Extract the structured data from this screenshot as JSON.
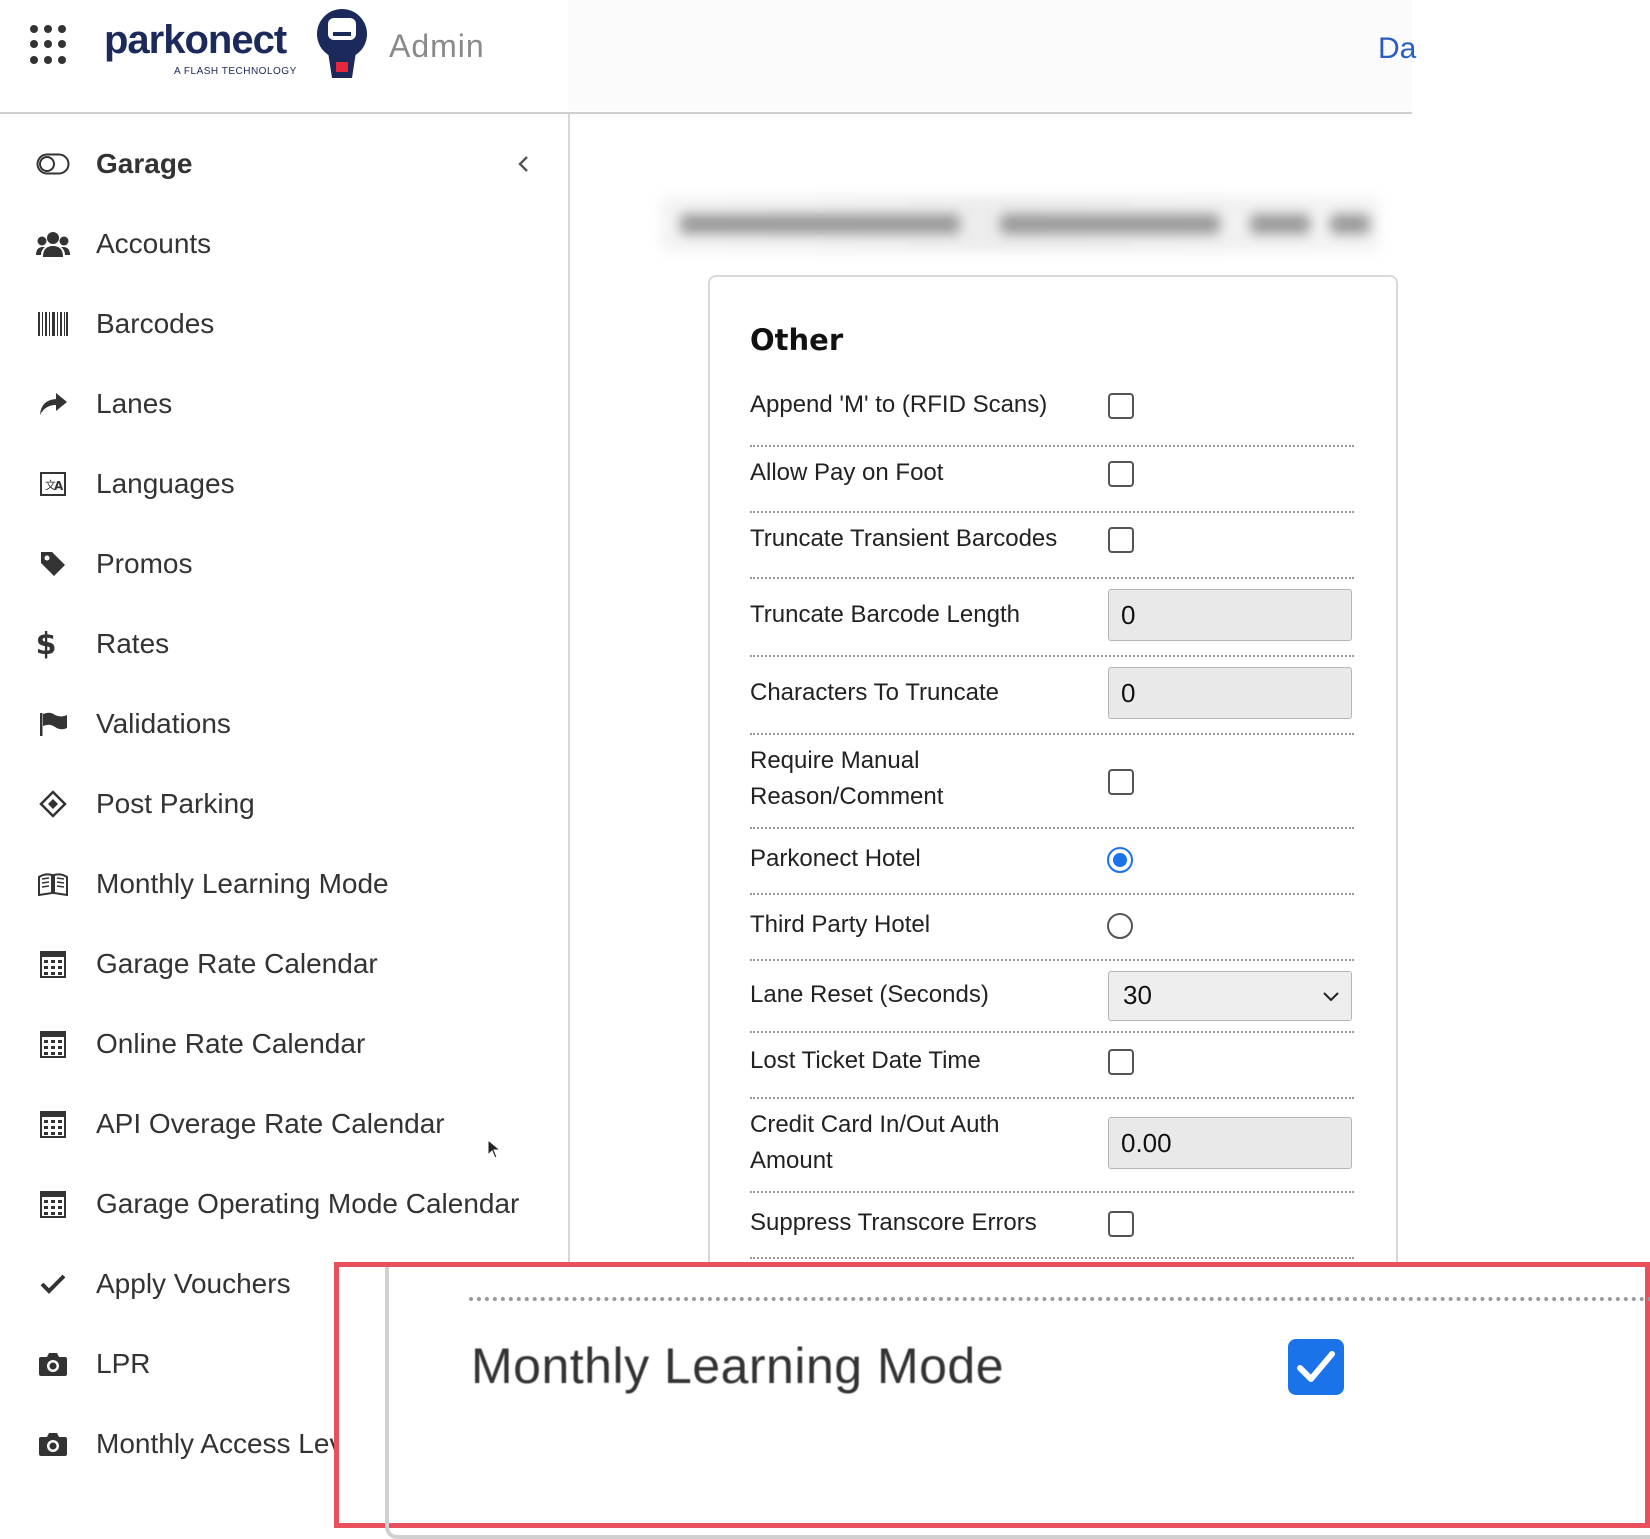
{
  "header": {
    "logo_text": "parkonect",
    "logo_tagline": "A FLASH TECHNOLOGY",
    "app_label": "Admin",
    "link_text": "Da"
  },
  "sidebar": {
    "items": [
      {
        "label": "Garage",
        "icon": "toggle-icon",
        "active": true
      },
      {
        "label": "Accounts",
        "icon": "users-icon"
      },
      {
        "label": "Barcodes",
        "icon": "barcode-icon"
      },
      {
        "label": "Lanes",
        "icon": "share-arrow-icon"
      },
      {
        "label": "Languages",
        "icon": "language-icon"
      },
      {
        "label": "Promos",
        "icon": "tag-icon"
      },
      {
        "label": "Rates",
        "icon": "dollar-icon"
      },
      {
        "label": "Validations",
        "icon": "flag-icon"
      },
      {
        "label": "Post Parking",
        "icon": "ticket-icon"
      },
      {
        "label": "Monthly Learning Mode",
        "icon": "book-icon"
      },
      {
        "label": "Garage Rate Calendar",
        "icon": "calendar-icon"
      },
      {
        "label": "Online Rate Calendar",
        "icon": "calendar-icon"
      },
      {
        "label": "API Overage Rate Calendar",
        "icon": "calendar-icon"
      },
      {
        "label": "Garage Operating Mode Calendar",
        "icon": "calendar-icon"
      },
      {
        "label": "Apply Vouchers",
        "icon": "check-icon"
      },
      {
        "label": "LPR",
        "icon": "camera-icon"
      },
      {
        "label": "Monthly Access Lev",
        "icon": "camera-icon"
      }
    ]
  },
  "panel": {
    "title": "Other",
    "rows": [
      {
        "label": "Append 'M' to (RFID Scans)",
        "type": "checkbox",
        "checked": false
      },
      {
        "label": "Allow Pay on Foot",
        "type": "checkbox",
        "checked": false
      },
      {
        "label": "Truncate Transient Barcodes",
        "type": "checkbox",
        "checked": false
      },
      {
        "label": "Truncate Barcode Length",
        "type": "input",
        "value": "0"
      },
      {
        "label": "Characters To Truncate",
        "type": "input",
        "value": "0"
      },
      {
        "label": "Require Manual Reason/Comment",
        "type": "checkbox",
        "checked": false
      },
      {
        "label": "Parkonect Hotel",
        "type": "radio",
        "checked": true
      },
      {
        "label": "Third Party Hotel",
        "type": "radio",
        "checked": false
      },
      {
        "label": "Lane Reset (Seconds)",
        "type": "select",
        "value": "30"
      },
      {
        "label": "Lost Ticket Date Time",
        "type": "checkbox",
        "checked": false
      },
      {
        "label": "Credit Card In/Out Auth Amount",
        "type": "input",
        "value": "0.00"
      },
      {
        "label": "Suppress Transcore Errors",
        "type": "checkbox",
        "checked": false
      }
    ]
  },
  "callout": {
    "label": "Monthly Learning Mode",
    "checked": true,
    "border_color": "#e8505e"
  },
  "colors": {
    "accent": "#1a73e8",
    "brand": "#1b2a5a",
    "link": "#2a5dc2"
  }
}
